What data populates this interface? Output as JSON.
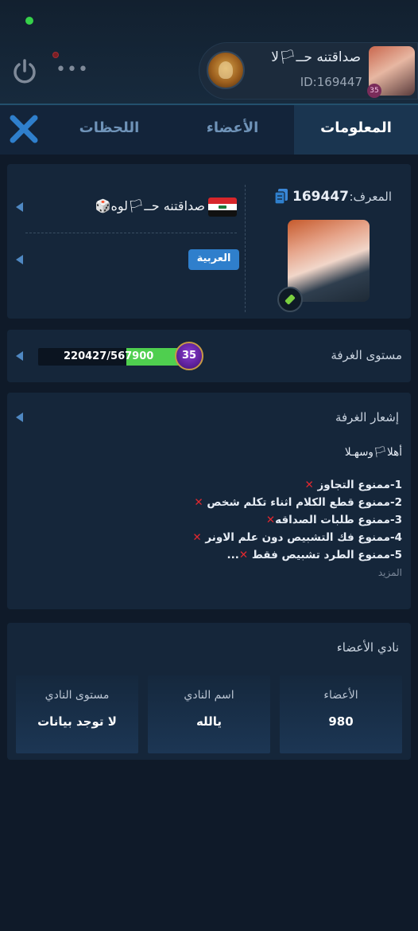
{
  "header": {
    "owner_name": "صداقتنه حــ🏳لا",
    "owner_id": "ID:169447",
    "owner_level": "35",
    "more_label": "•••"
  },
  "tabs": [
    {
      "label": "المعلومات",
      "active": true
    },
    {
      "label": "الأعضاء",
      "active": false
    },
    {
      "label": "اللحظات",
      "active": false
    }
  ],
  "info": {
    "id_label": "المعرف:",
    "id_value": "169447",
    "room_name": "صداقتنه حــ🏳لوه🎲",
    "language": "العربية"
  },
  "level": {
    "label": "مستوى الغرفة",
    "xp_text": "220427/567900",
    "progress": 0.388,
    "badge": "35"
  },
  "notice": {
    "title": "إشعار الغرفة",
    "greeting": "أهلا🏳وسهـلا",
    "lines": [
      {
        "num": "1-",
        "text": "ممنوع التجاوز ",
        "tail": ""
      },
      {
        "num": "2-",
        "text": "ممنوع قطع الكلام اثناء تكلم شخص ",
        "tail": ""
      },
      {
        "num": "3-",
        "text": "ممنوع طلبات الصداقه",
        "tail": ""
      },
      {
        "num": "4-",
        "text": "ممنوع فك التشبيص دون علم الاونر ",
        "tail": ""
      },
      {
        "num": "5-",
        "text": "ممنوع الطرد تشبيص فقط ",
        "tail": "..."
      }
    ],
    "x_symbol": "✕",
    "more": "المزيد"
  },
  "club": {
    "title": "نادي الأعضاء",
    "cells": [
      {
        "label": "الأعضاء",
        "value": "980"
      },
      {
        "label": "اسم النادي",
        "value": "يالله"
      },
      {
        "label": "مستوى النادي",
        "value": "لا توجد بيانات"
      }
    ]
  },
  "colors": {
    "accent": "#2f7fcc",
    "online": "#36d14a",
    "xp": "#4fcf4f",
    "danger": "#e0282f"
  },
  "icons": [
    "power-icon",
    "more-icon",
    "close-icon",
    "copy-icon",
    "dice-icon",
    "edit-icon",
    "flag-icon",
    "level-icon"
  ]
}
